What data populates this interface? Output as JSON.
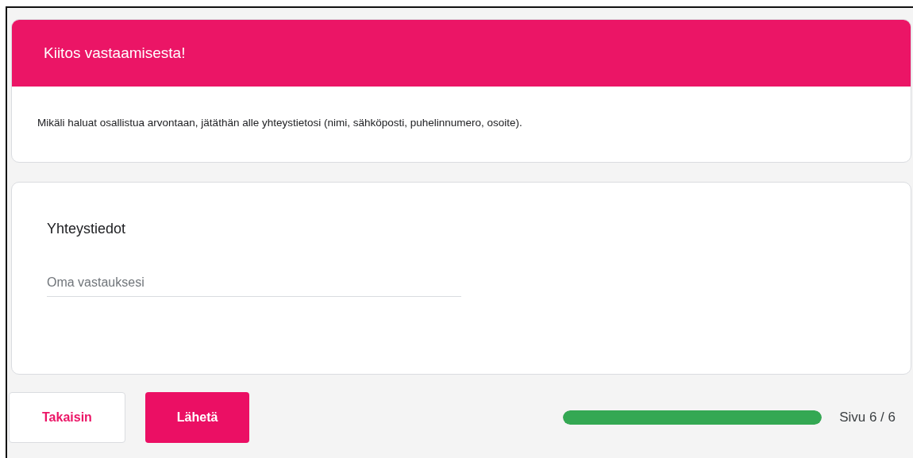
{
  "header": {
    "title": "Kiitos vastaamisesta!",
    "description": "Mikäli haluat osallistua arvontaan, jätäthän alle yhteystietosi (nimi, sähköposti, puhelinnumero, osoite)."
  },
  "question": {
    "title": "Yhteystiedot",
    "placeholder": "Oma vastauksesi"
  },
  "buttons": [
    {
      "kind": "secondary",
      "label": "Takaisin"
    },
    {
      "kind": "primary",
      "label": "Lähetä"
    }
  ],
  "progress": {
    "level": 1,
    "label": "Sivu 6 / 6"
  }
}
